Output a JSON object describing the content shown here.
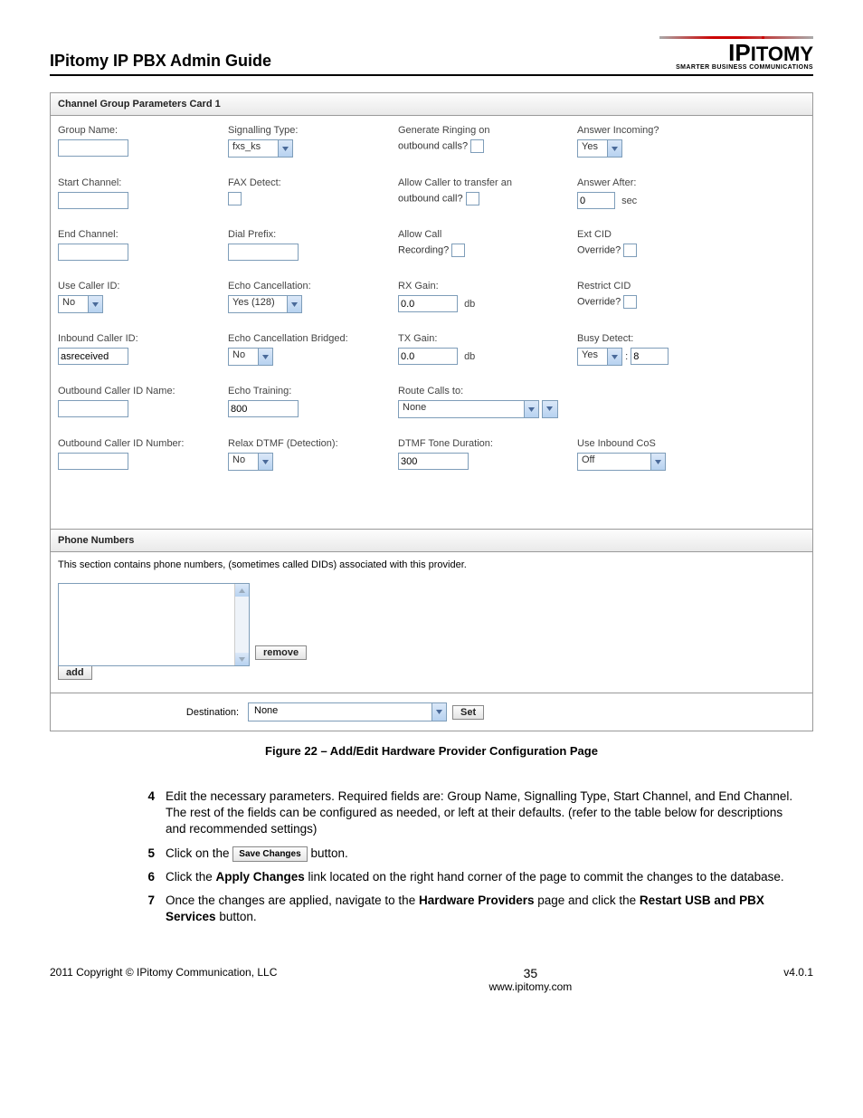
{
  "header": {
    "title": "IPitomy IP PBX Admin Guide",
    "logo_brand": "IPITOMY",
    "logo_tag": "SMARTER BUSINESS COMMUNICATIONS"
  },
  "card": {
    "title": "Channel Group Parameters Card 1",
    "c1": {
      "group_name": {
        "label": "Group Name:",
        "value": ""
      },
      "start_channel": {
        "label": "Start Channel:",
        "value": ""
      },
      "end_channel": {
        "label": "End Channel:",
        "value": ""
      },
      "use_caller_id": {
        "label": "Use Caller ID:",
        "value": "No"
      },
      "inbound_cid": {
        "label": "Inbound Caller ID:",
        "value": "asreceived"
      },
      "out_cid_name": {
        "label": "Outbound Caller ID Name:",
        "value": ""
      },
      "out_cid_num": {
        "label": "Outbound Caller ID Number:",
        "value": ""
      }
    },
    "c2": {
      "sig_type": {
        "label": "Signalling Type:",
        "value": "fxs_ks"
      },
      "fax_detect": {
        "label": "FAX Detect:"
      },
      "dial_prefix": {
        "label": "Dial Prefix:",
        "value": ""
      },
      "echo_cancel": {
        "label": "Echo Cancellation:",
        "value": "Yes (128)"
      },
      "echo_bridged": {
        "label": "Echo Cancellation Bridged:",
        "value": "No"
      },
      "echo_training": {
        "label": "Echo Training:",
        "value": "800"
      },
      "relax_dtmf": {
        "label": "Relax DTMF (Detection):",
        "value": "No"
      }
    },
    "c3": {
      "gen_ring": {
        "label1": "Generate Ringing on",
        "label2": "outbound calls?"
      },
      "allow_transfer": {
        "label1": "Allow Caller to transfer an",
        "label2": "outbound call?"
      },
      "allow_record": {
        "label1": "Allow Call",
        "label2": "Recording?"
      },
      "rx_gain": {
        "label": "RX Gain:",
        "value": "0.0",
        "unit": "db"
      },
      "tx_gain": {
        "label": "TX Gain:",
        "value": "0.0",
        "unit": "db"
      },
      "route_calls": {
        "label": "Route Calls to:",
        "value": "None"
      },
      "dtmf_dur": {
        "label": "DTMF Tone Duration:",
        "value": "300"
      }
    },
    "c4": {
      "answer_incoming": {
        "label": "Answer Incoming?",
        "value": "Yes"
      },
      "answer_after": {
        "label": "Answer After:",
        "value": "0",
        "unit": "sec"
      },
      "ext_cid": {
        "label1": "Ext CID",
        "label2": "Override?"
      },
      "restrict_cid": {
        "label1": "Restrict CID",
        "label2": "Override?"
      },
      "busy_detect": {
        "label": "Busy Detect:",
        "value": "Yes",
        "count": "8"
      },
      "use_cos": {
        "label": "Use Inbound CoS",
        "value": "Off"
      }
    }
  },
  "phone": {
    "title": "Phone Numbers",
    "desc": "This section contains phone numbers, (sometimes called DIDs) associated with this provider.",
    "remove": "remove",
    "add": "add",
    "dest_label": "Destination:",
    "dest_value": "None",
    "set": "Set"
  },
  "figure_caption": "Figure 22 – Add/Edit Hardware Provider Configuration Page",
  "steps": {
    "s4": {
      "num": "4",
      "text_a": "Edit the necessary parameters.  Required fields are: Group Name, Signalling Type, Start Channel, and End Channel. The rest of the fields can be configured as needed, or left at their defaults. (refer to the table below for descriptions and recommended settings)"
    },
    "s5": {
      "num": "5",
      "pre": "Click on the ",
      "btn": "Save Changes",
      "post": " button."
    },
    "s6": {
      "num": "6",
      "pre": "Click the ",
      "bold": "Apply Changes",
      "post": " link located on the right hand corner of the page to commit the changes to the database."
    },
    "s7": {
      "num": "7",
      "pre": "Once the changes are applied, navigate to the ",
      "b1": "Hardware Providers",
      "mid": " page and click the ",
      "b2": "Restart USB and PBX Services",
      "post": " button."
    }
  },
  "footer": {
    "copyright": "2011 Copyright © IPitomy Communication, LLC",
    "page": "35",
    "url": "www.ipitomy.com",
    "version": "v4.0.1"
  }
}
